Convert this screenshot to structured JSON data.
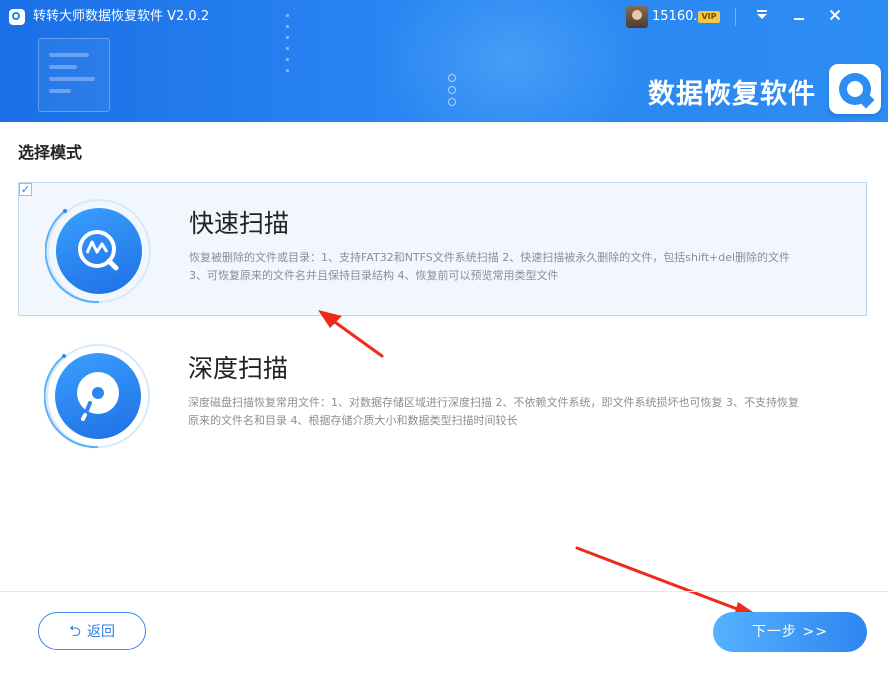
{
  "window": {
    "title": "转转大师数据恢复软件 V2.0.2",
    "user_name": "15160...",
    "vip_label": "VIP",
    "minimize_icon": "minimize-icon",
    "close_icon": "close-icon",
    "dropdown_icon": "menu-dropdown-icon"
  },
  "header": {
    "brand_text": "数据恢复软件",
    "accent_color": "#2c8df3"
  },
  "main": {
    "section_title": "选择模式",
    "options": [
      {
        "title": "快速扫描",
        "description": "恢复被删除的文件或目录：1、支持FAT32和NTFS文件系统扫描 2、快速扫描被永久删除的文件，包括shift+del删除的文件 3、可恢复原来的文件名并且保持目录结构 4、恢复前可以预览常用类型文件",
        "selected": true,
        "icon": "quick-scan-icon"
      },
      {
        "title": "深度扫描",
        "description": "深度磁盘扫描恢复常用文件：1、对数据存储区域进行深度扫描 2、不依赖文件系统，即文件系统损坏也可恢复 3、不支持恢复原来的文件名和目录 4、根据存储介质大小和数据类型扫描时间较长",
        "selected": false,
        "icon": "deep-scan-icon"
      }
    ]
  },
  "footer": {
    "back_label": "返回",
    "next_label": "下一步 >>"
  }
}
